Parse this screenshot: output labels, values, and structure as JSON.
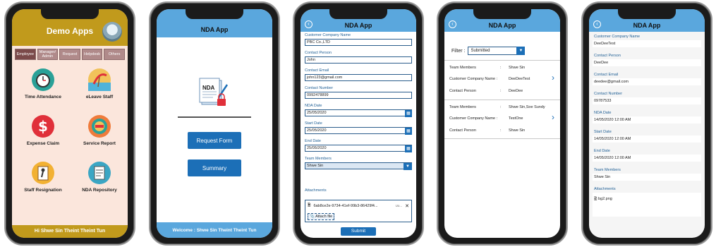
{
  "phone1": {
    "title": "Demo Apps",
    "tabs": [
      "Employee",
      "Manager/ Admin",
      "Request",
      "Helpdesk",
      "Others"
    ],
    "items": [
      {
        "label": "Time Attendance",
        "icon": "clock-icon",
        "color": "#2aa198"
      },
      {
        "label": "eLeave Staff",
        "icon": "beach-icon",
        "color": "#f1c25a"
      },
      {
        "label": "Expense Claim",
        "icon": "dollar-icon",
        "color": "#e0303a"
      },
      {
        "label": "Service Report",
        "icon": "report-icon",
        "color": "#ef7b3b"
      },
      {
        "label": "Staff Resignation",
        "icon": "exit-icon",
        "color": "#f2b133"
      },
      {
        "label": "NDA Repository",
        "icon": "repository-icon",
        "color": "#3ba6c4"
      }
    ],
    "footer": "Hi Shwe Sin Theint Theint Tun"
  },
  "phone2": {
    "title": "NDA App",
    "doc_label": "NDA",
    "buttons": [
      "Request Form",
      "Summary"
    ],
    "footer": "Welcome : Shwe Sin Theint Theint Tun"
  },
  "phone3": {
    "title": "NDA App",
    "fields": [
      {
        "label": "Customer Company Name",
        "value": "PBC Co.,LTD"
      },
      {
        "label": "Contact Person",
        "value": "John"
      },
      {
        "label": "Contact Email",
        "value": "john123@gmail.com"
      },
      {
        "label": "Contact Number",
        "value": "0992478899"
      },
      {
        "label": "NDA Date",
        "value": "25/05/2020"
      },
      {
        "label": "Start Date",
        "value": "25/05/2020"
      },
      {
        "label": "End Date",
        "value": "25/05/2020"
      },
      {
        "label": "Team Members",
        "value": "Shwe Sin"
      }
    ],
    "attachments_label": "Attachments",
    "attachment_file": "6ab8ce2e-9734-41ef-99b3-86429f4...",
    "attachment_size": "Uo...",
    "attach_file": "Attach file",
    "submit": "Submit"
  },
  "phone4": {
    "title": "NDA App",
    "filter_label": "Filter :",
    "filter_value": "Submitted",
    "records": [
      {
        "team_label": "Team Members",
        "team": "Shwe Sin",
        "company_label": "Customer Company Name :",
        "company": "DeeDeeTest",
        "contact_label": "Contact Person",
        "contact": "DeeDee"
      },
      {
        "team_label": "Team Members",
        "team": "Shwe Sin,Soe Sundy",
        "company_label": "Customer Company Name :",
        "company": "TestOne",
        "contact_label": "Contact Person",
        "contact": "Shwe Sin"
      }
    ]
  },
  "phone5": {
    "title": "NDA App",
    "fields": [
      {
        "label": "Customer Company Name",
        "value": "DeeDeeTest"
      },
      {
        "label": "Contact Person",
        "value": "DeeDee"
      },
      {
        "label": "Contact Email",
        "value": "deedee@gmail.com"
      },
      {
        "label": "Contact Number",
        "value": "09787533"
      },
      {
        "label": "NDA Date",
        "value": "14/05/2020 12:00 AM"
      },
      {
        "label": "Start Date",
        "value": "14/05/2020 12:00 AM"
      },
      {
        "label": "End Date",
        "value": "14/05/2020 12:00 AM"
      },
      {
        "label": "Team Members",
        "value": "Shwe Sin"
      }
    ],
    "attachments_label": "Attachments",
    "attachment_file": "bg2.png"
  }
}
